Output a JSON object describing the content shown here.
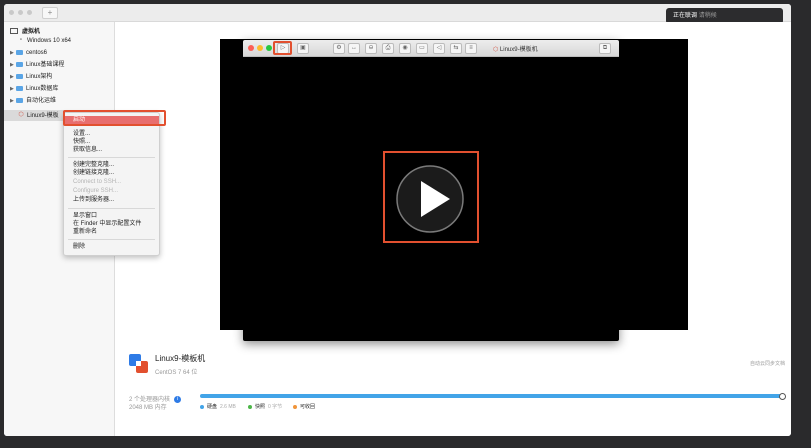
{
  "notification": {
    "title": "正在联调",
    "subtitle": "请稍候"
  },
  "sidebar": {
    "header": "虚拟机",
    "items": [
      {
        "label": "Windows 10 x64",
        "kind": "vm"
      },
      {
        "label": "centos6",
        "kind": "folder"
      },
      {
        "label": "Linux基础课程",
        "kind": "folder"
      },
      {
        "label": "Linux架构",
        "kind": "folder"
      },
      {
        "label": "Linux数据库",
        "kind": "folder"
      },
      {
        "label": "自动化运维",
        "kind": "folder"
      },
      {
        "label": "Linux9-模板",
        "kind": "vm",
        "selected": true
      }
    ]
  },
  "context_menu": {
    "items": [
      {
        "label": "启动",
        "active": true
      },
      {
        "label": "设置..."
      },
      {
        "label": "快照..."
      },
      {
        "label": "获取信息..."
      },
      {
        "label": "创建完整克隆..."
      },
      {
        "label": "创建链接克隆..."
      },
      {
        "label": "Connect to SSH...",
        "disabled": true
      },
      {
        "label": "Configure SSH...",
        "disabled": true
      },
      {
        "label": "上传到服务器..."
      },
      {
        "label": "显示窗口"
      },
      {
        "label": "在 Finder 中显示配置文件"
      },
      {
        "label": "重新命名"
      },
      {
        "label": "删除"
      }
    ]
  },
  "vm_window": {
    "title": "Linux9-模板机",
    "toolbar_icons": [
      "play-icon",
      "snapshot-icon",
      "settings-icon",
      "network-icon",
      "disk-icon",
      "printer-icon",
      "sound-icon",
      "camera-icon",
      "share-icon",
      "usb-icon",
      "fullscreen-icon"
    ]
  },
  "vm_info": {
    "name": "Linux9-模板机",
    "os": "CentOS 7 64 位",
    "right_label": "自动云同步文档",
    "processors": "2 个处理器内核",
    "memory": "2048 MB 内存",
    "legend": [
      {
        "label": "硬盘",
        "value": "2.6 MB",
        "color": "#42a4e8"
      },
      {
        "label": "快照",
        "value": "0 字节",
        "color": "#4cb648"
      },
      {
        "label": "可收回",
        "value": "",
        "color": "#f0953a"
      }
    ]
  },
  "colors": {
    "highlight": "#e2502f",
    "context_active": "#e86e6e",
    "storage": "#42a4e8"
  }
}
